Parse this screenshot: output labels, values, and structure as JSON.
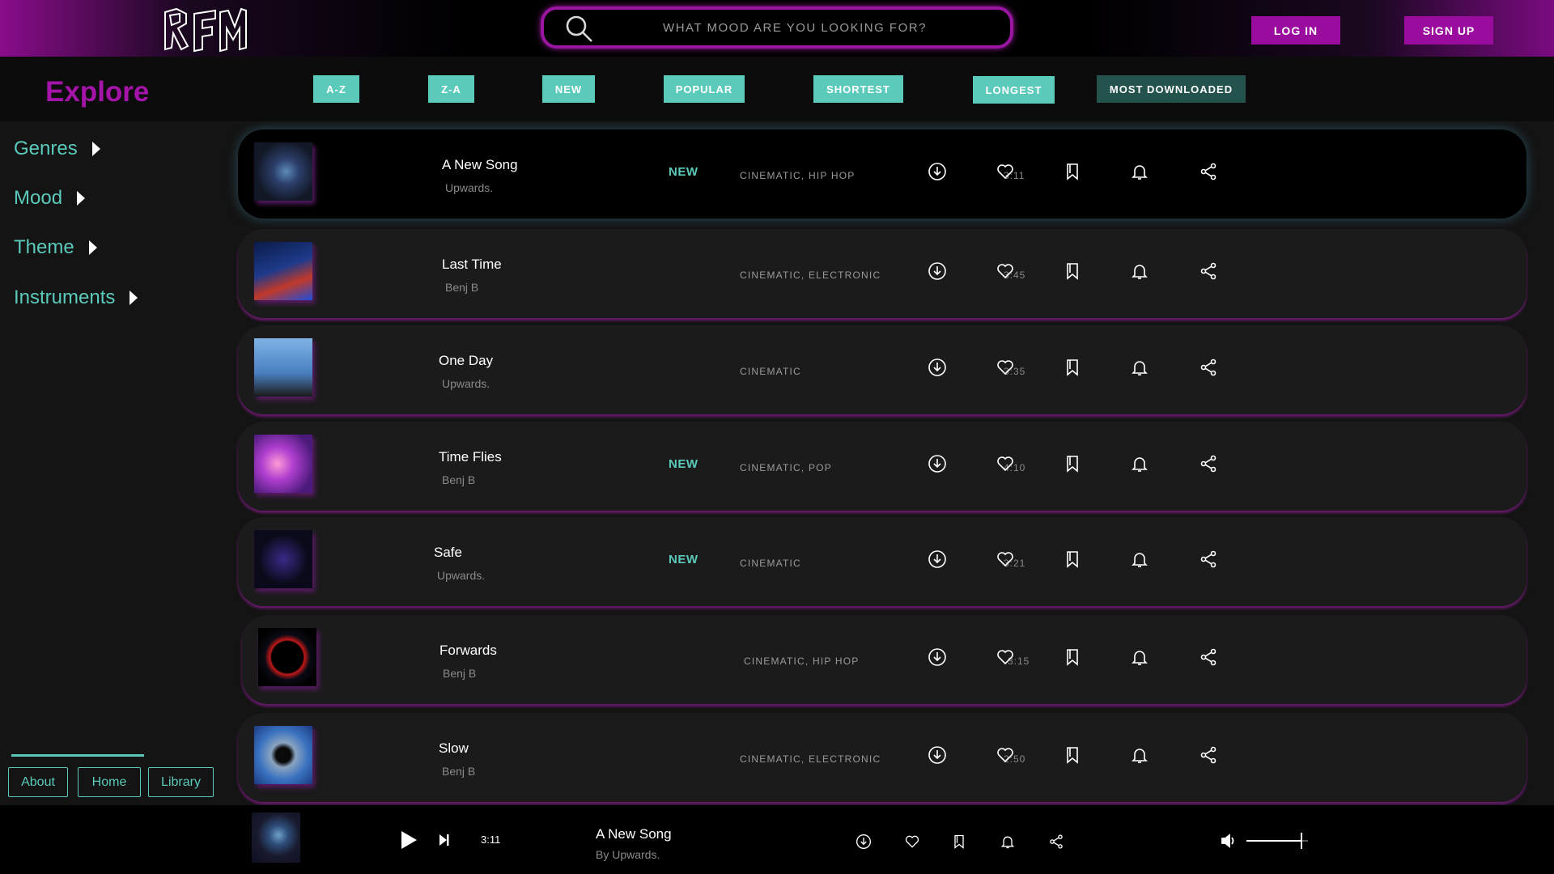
{
  "colors": {
    "accent_purple": "#9a0c9e",
    "accent_teal": "#5ccabb",
    "row_bg": "#1b1b1b",
    "page_bg": "#141414"
  },
  "header": {
    "logo_text": "RFM",
    "search": {
      "placeholder": "WHAT MOOD ARE YOU LOOKING FOR?",
      "value": ""
    },
    "login_label": "LOG IN",
    "signup_label": "SIGN UP"
  },
  "explore": {
    "title": "Explore",
    "filters": [
      "A-Z",
      "Z-A",
      "NEW",
      "POPULAR",
      "SHORTEST",
      "LONGEST",
      "MOST DOWNLOADED"
    ]
  },
  "sidebar": {
    "items": [
      {
        "label": "Genres"
      },
      {
        "label": "Mood"
      },
      {
        "label": "Theme"
      },
      {
        "label": "Instruments"
      }
    ],
    "footer_links": [
      "About",
      "Home",
      "Library"
    ]
  },
  "tracks": [
    {
      "title": "A New Song",
      "artist": "Upwards.",
      "badge": "NEW",
      "genres": "CINEMATIC, HIP HOP",
      "duration": "3:11"
    },
    {
      "title": "Last Time",
      "artist": "Benj B",
      "badge": "",
      "genres": "CINEMATIC, ELECTRONIC",
      "duration": "3:45"
    },
    {
      "title": "One Day",
      "artist": "Upwards.",
      "badge": "",
      "genres": "CINEMATIC",
      "duration": "3:35"
    },
    {
      "title": "Time Flies",
      "artist": "Benj B",
      "badge": "NEW",
      "genres": "CINEMATIC, POP",
      "duration": "4:10"
    },
    {
      "title": "Safe",
      "artist": "Upwards.",
      "badge": "NEW",
      "genres": "CINEMATIC",
      "duration": "3:21"
    },
    {
      "title": "Forwards",
      "artist": "Benj B",
      "badge": "",
      "genres": "CINEMATIC, HIP HOP",
      "duration": "3:15"
    },
    {
      "title": "Slow",
      "artist": "Benj B",
      "badge": "",
      "genres": "CINEMATIC, ELECTRONIC",
      "duration": "2:50"
    }
  ],
  "row_icons": [
    "download-icon",
    "heart-icon",
    "bookmark-icon",
    "bell-icon",
    "share-icon"
  ],
  "player": {
    "title": "A New Song",
    "artist": "By Upwards.",
    "time": "3:11",
    "volume_level": 0.9
  }
}
